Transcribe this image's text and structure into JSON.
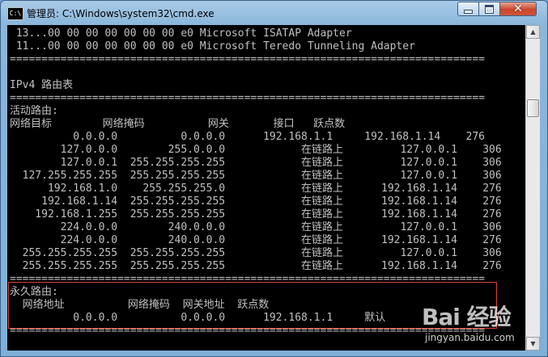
{
  "window": {
    "title": "管理员: C:\\Windows\\system32\\cmd.exe",
    "icon_text": "C:\\",
    "controls": {
      "minimize": "minimize-icon",
      "maximize": "maximize-icon",
      "close": "close-icon",
      "close_glyph": "✕"
    }
  },
  "console": {
    "lines": [
      " 13...00 00 00 00 00 00 00 e0 Microsoft ISATAP Adapter",
      " 11...00 00 00 00 00 00 00 e0 Microsoft Teredo Tunneling Adapter",
      "===========================================================================",
      "",
      "IPv4 路由表",
      "===========================================================================",
      "活动路由:",
      "网络目标        网络掩码          网关       接口   跃点数",
      "          0.0.0.0          0.0.0.0      192.168.1.1     192.168.1.14    276",
      "        127.0.0.0        255.0.0.0            在链路上         127.0.0.1    306",
      "        127.0.0.1  255.255.255.255            在链路上         127.0.0.1    306",
      "  127.255.255.255  255.255.255.255            在链路上         127.0.0.1    306",
      "      192.168.1.0    255.255.255.0            在链路上      192.168.1.14    276",
      "     192.168.1.14  255.255.255.255            在链路上      192.168.1.14    276",
      "    192.168.1.255  255.255.255.255            在链路上      192.168.1.14    276",
      "        224.0.0.0        240.0.0.0            在链路上         127.0.0.1    306",
      "        224.0.0.0        240.0.0.0            在链路上      192.168.1.14    276",
      "  255.255.255.255  255.255.255.255            在链路上         127.0.0.1    306",
      "  255.255.255.255  255.255.255.255            在链路上      192.168.1.14    276",
      "===========================================================================",
      "永久路由:",
      "  网络地址          网络掩码  网关地址  跃点数",
      "          0.0.0.0          0.0.0.0      192.168.1.1     默认",
      "==========================================================================="
    ]
  },
  "scrollbar": {
    "up_icon": "▲",
    "down_icon": "▼"
  },
  "watermark": {
    "logo": "Bai 经验",
    "url": "jingyan.baidu.com"
  }
}
